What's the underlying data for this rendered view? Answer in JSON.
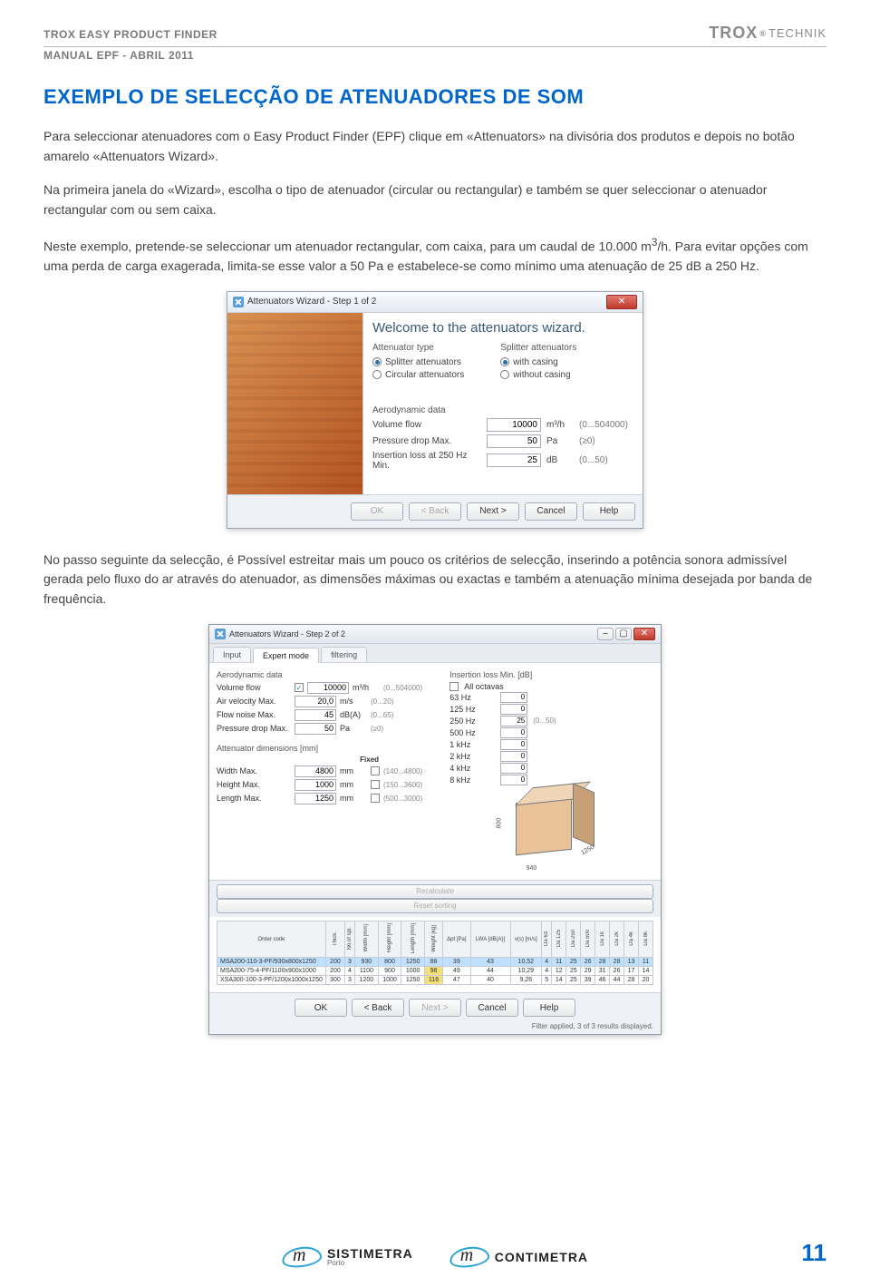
{
  "header": {
    "left1": "TROX EASY PRODUCT FINDER",
    "left2": "MANUAL EPF - ABRIL 2011",
    "logo_main": "TROX",
    "logo_sub": "TECHNIK",
    "logo_reg": "®"
  },
  "title": "EXEMPLO DE SELECÇÃO DE ATENUADORES DE SOM",
  "para1": "Para seleccionar atenuadores com o Easy Product Finder (EPF) clique em «Attenuators» na divisória dos produtos e depois no botão amarelo «Attenuators Wizard».",
  "para2": "Na primeira janela do «Wizard», escolha o tipo de atenuador (circular ou rectangular) e também se quer seleccionar o atenuador rectangular com ou sem caixa.",
  "para3_a": "Neste exemplo, pretende-se seleccionar um atenuador rectangular, com caixa, para um caudal de 10.000 m",
  "para3_sup": "3",
  "para3_b": "/h. Para evitar opções com uma perda de carga exagerada, limita-se esse valor a 50 Pa e estabelece-se como mínimo uma atenuação de 25 dB a 250 Hz.",
  "wiz1": {
    "title": "Attenuators Wizard - Step 1 of 2",
    "welcome": "Welcome to the attenuators wizard.",
    "group_left": "Attenuator type",
    "opt_splitter": "Splitter attenuators",
    "opt_circular": "Circular attenuators",
    "group_right": "Splitter attenuators",
    "opt_with": "with casing",
    "opt_without": "without casing",
    "aero_title": "Aerodynamic data",
    "row_vf_lbl": "Volume flow",
    "row_vf_val": "10000",
    "row_vf_unit": "m³/h",
    "row_vf_range": "(0...504000)",
    "row_pd_lbl": "Pressure drop Max.",
    "row_pd_val": "50",
    "row_pd_unit": "Pa",
    "row_pd_range": "(≥0)",
    "row_il_lbl": "Insertion loss at 250 Hz Min.",
    "row_il_val": "25",
    "row_il_unit": "dB",
    "row_il_range": "(0...50)",
    "btn_ok": "OK",
    "btn_back": "< Back",
    "btn_next": "Next >",
    "btn_cancel": "Cancel",
    "btn_help": "Help"
  },
  "para4": "No passo seguinte da selecção, é Possível estreitar mais um pouco os critérios de selecção, inserindo a potência sonora admissível gerada pelo fluxo do ar através do atenuador, as dimensões máximas ou exactas e também a atenuação mínima desejada por banda de frequência.",
  "wiz2": {
    "title": "Attenuators Wizard - Step 2 of 2",
    "tab_input": "Input",
    "tab_expert": "Expert mode",
    "tab_filter": "filtering",
    "aero_title": "Aerodynamic data",
    "vf_lbl": "Volume flow",
    "vf_val": "10000",
    "vf_unit": "m³/h",
    "vf_range": "(0...504000)",
    "av_lbl": "Air velocity Max.",
    "av_val": "20,0",
    "av_unit": "m/s",
    "av_range": "(0...20)",
    "fn_lbl": "Flow noise Max.",
    "fn_val": "45",
    "fn_unit": "dB(A)",
    "fn_range": "(0...65)",
    "pd_lbl": "Pressure drop Max.",
    "pd_val": "50",
    "pd_unit": "Pa",
    "pd_range": "(≥0)",
    "dim_title": "Attenuator dimensions [mm]",
    "fixed": "Fixed",
    "wmax_lbl": "Width Max.",
    "wmax_val": "4800",
    "wmax_unit": "mm",
    "wmax_range": "(140...4800)",
    "hmax_lbl": "Height Max.",
    "hmax_val": "1000",
    "hmax_unit": "mm",
    "hmax_range": "(150...3600)",
    "lmax_lbl": "Length Max.",
    "lmax_val": "1250",
    "lmax_unit": "mm",
    "lmax_range": "(500...3000)",
    "il_title": "Insertion loss Min. [dB]",
    "all_oct": "All octavas",
    "oc63": "63 Hz",
    "oc63_v": "0",
    "oc125": "125 Hz",
    "oc125_v": "0",
    "oc250": "250 Hz",
    "oc250_v": "25",
    "oc250_r": "(0...50)",
    "oc500": "500 Hz",
    "oc500_v": "0",
    "oc1k": "1 kHz",
    "oc1k_v": "0",
    "oc2k": "2 kHz",
    "oc2k_v": "0",
    "oc4k": "4 kHz",
    "oc4k_v": "0",
    "oc8k": "8 kHz",
    "oc8k_v": "0",
    "dim_h": "800",
    "dim_w": "940",
    "dim_l": "1250",
    "recalc": "Recalculate",
    "reset": "Reset sorting",
    "th_order": "Order code",
    "th_thick": "Thick.",
    "th_nspl": "No.of spl.",
    "th_w": "Width [mm]",
    "th_h": "Height [mm]",
    "th_l": "Length [mm]",
    "th_wt": "Weight [kg]",
    "th_dpt": "Δpt [Pa]",
    "th_lwa": "LWA [dB(A)]",
    "th_v": "v(s) [m/s]",
    "th_d63": "Da 63",
    "th_d125": "Da 125",
    "th_d250": "Da 250",
    "th_d500": "Da 500",
    "th_d1k": "Da 1k",
    "th_d2k": "Da 2k",
    "th_d4k": "Da 4k",
    "th_d8k": "Da 8k",
    "r1": {
      "oc": "MSA200-110-3-PF/930x800x1250",
      "thick": "200",
      "nspl": "3",
      "w": "930",
      "h": "800",
      "l": "1250",
      "wt": "88",
      "dpt": "39",
      "lwa": "43",
      "v": "10,52",
      "d63": "4",
      "d125": "11",
      "d250": "25",
      "d500": "26",
      "d1k": "28",
      "d2k": "28",
      "d4k": "13",
      "d8k": "11"
    },
    "r2": {
      "oc": "MSA200-75-4-PF/1100x900x1000",
      "thick": "200",
      "nspl": "4",
      "w": "1100",
      "h": "900",
      "l": "1000",
      "wt": "98",
      "dpt": "49",
      "lwa": "44",
      "v": "10,29",
      "d63": "4",
      "d125": "12",
      "d250": "25",
      "d500": "29",
      "d1k": "31",
      "d2k": "26",
      "d4k": "17",
      "d8k": "14"
    },
    "r3": {
      "oc": "XSA300-100-3-PF/1200x1000x1250",
      "thick": "300",
      "nspl": "3",
      "w": "1200",
      "h": "1000",
      "l": "1250",
      "wt": "116",
      "dpt": "47",
      "lwa": "40",
      "v": "9,26",
      "d63": "5",
      "d125": "14",
      "d250": "25",
      "d500": "39",
      "d1k": "46",
      "d2k": "44",
      "d4k": "28",
      "d8k": "20"
    },
    "btn_ok": "OK",
    "btn_back": "< Back",
    "btn_next": "Next >",
    "btn_cancel": "Cancel",
    "btn_help": "Help",
    "filter_msg": "Filter applied, 3 of 3 results displayed."
  },
  "footer": {
    "logo1": "SISTIMETRA",
    "logo1_sub": "Porto",
    "logo2": "CONTIMETRA",
    "page": "11"
  }
}
